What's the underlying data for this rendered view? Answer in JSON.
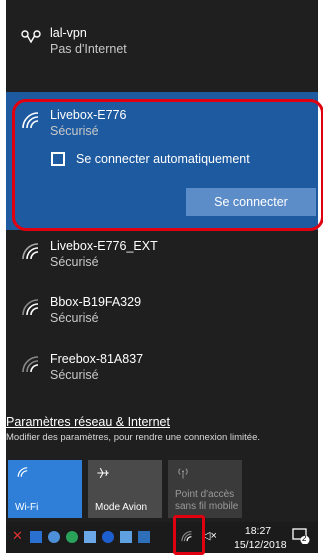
{
  "networks": [
    {
      "name": "lal-vpn",
      "status": "Pas d'Internet",
      "icon": "vpn-icon"
    },
    {
      "name": "Livebox-E776",
      "status": "Sécurisé",
      "icon": "wifi-icon"
    },
    {
      "name": "Livebox-E776_EXT",
      "status": "Sécurisé",
      "icon": "wifi-icon"
    },
    {
      "name": "Bbox-B19FA329",
      "status": "Sécurisé",
      "icon": "wifi-icon"
    },
    {
      "name": "Freebox-81A837",
      "status": "Sécurisé",
      "icon": "wifi-icon"
    }
  ],
  "expanded": {
    "auto_connect_label": "Se connecter automatiquement",
    "auto_connect_checked": false,
    "connect_button": "Se connecter"
  },
  "settings": {
    "link": "Paramètres réseau & Internet",
    "description": "Modifier des paramètres, pour rendre une connexion limitée."
  },
  "quick_actions": [
    {
      "label": "Wi-Fi",
      "state": "on",
      "icon": "wifi-icon"
    },
    {
      "label": "Mode Avion",
      "state": "off",
      "icon": "airplane-icon"
    },
    {
      "label": "Point d'accès sans fil mobile",
      "state": "disabled",
      "icon": "hotspot-icon"
    }
  ],
  "taskbar": {
    "time": "18:27",
    "date": "15/12/2018",
    "notification_count": "2"
  },
  "colors": {
    "flyout_bg": "#1f1f1f",
    "selected_bg": "#1e5aa0",
    "accent": "#2f7fd8",
    "highlight": "#e00010"
  }
}
